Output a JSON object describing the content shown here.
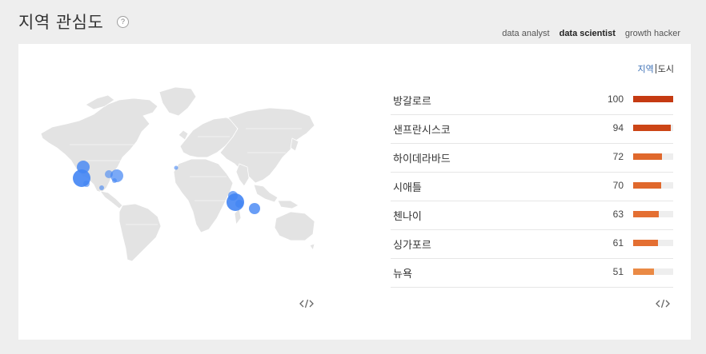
{
  "header": {
    "title": "지역 관심도",
    "help_label": "?"
  },
  "tabs": [
    {
      "label": "data analyst",
      "active": false
    },
    {
      "label": "data scientist",
      "active": true
    },
    {
      "label": "growth hacker",
      "active": false
    }
  ],
  "accent_color": "#d64a33",
  "view_toggle": {
    "region_label": "지역",
    "city_label": "도시",
    "selected": "region"
  },
  "map": {
    "bubble_color": "#4285f4",
    "icon": "world-map"
  },
  "cities": [
    {
      "name": "방갈로르",
      "value": 100,
      "color": "#c53a12"
    },
    {
      "name": "샌프란시스코",
      "value": 94,
      "color": "#cc4516"
    },
    {
      "name": "하이데라바드",
      "value": 72,
      "color": "#e0682c"
    },
    {
      "name": "시애틀",
      "value": 70,
      "color": "#e0682c"
    },
    {
      "name": "첸나이",
      "value": 63,
      "color": "#e46f32"
    },
    {
      "name": "싱가포르",
      "value": 61,
      "color": "#e46f32"
    },
    {
      "name": "뉴욕",
      "value": 51,
      "color": "#ea8a45"
    }
  ],
  "embed_icon": "code-icon"
}
